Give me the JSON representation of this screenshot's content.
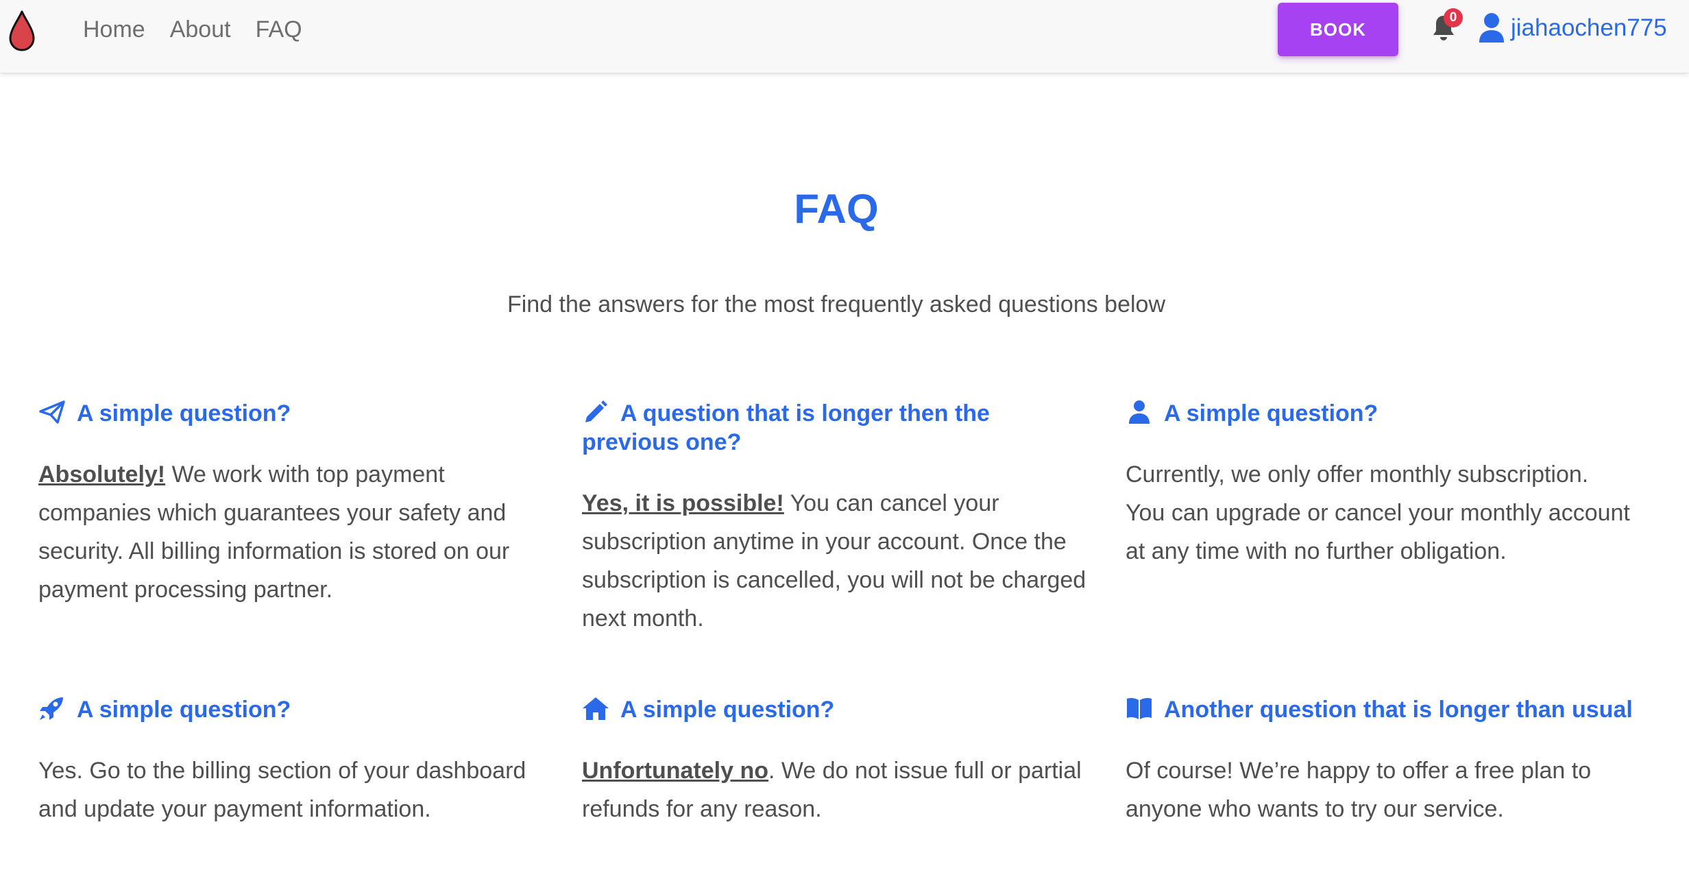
{
  "colors": {
    "brand_blue": "#2a6ae8",
    "book_purple": "#a742f2",
    "badge_red": "#e3344a",
    "logo_red": "#d9434a",
    "text_gray": "#4f4f4f"
  },
  "navbar": {
    "logo_icon": "blood-drop-icon",
    "links": [
      "Home",
      "About",
      "FAQ"
    ],
    "book_label": "BOOK",
    "notifications": {
      "icon": "bell-icon",
      "count": "0"
    },
    "user": {
      "icon": "user-icon",
      "name": "jiahaochen775"
    }
  },
  "header": {
    "title": "FAQ",
    "subtitle": "Find the answers for the most frequently asked questions below"
  },
  "faqs": [
    {
      "icon": "paper-plane-icon",
      "question": "A simple question?",
      "lead": "Absolutely!",
      "answer": " We work with top payment companies which guarantees your safety and security. All billing information is stored on our payment processing partner."
    },
    {
      "icon": "pencil-icon",
      "question": "A question that is longer then the previous one?",
      "lead": "Yes, it is possible!",
      "answer": " You can cancel your subscription anytime in your account. Once the subscription is cancelled, you will not be charged next month."
    },
    {
      "icon": "user-icon",
      "question": "A simple question?",
      "lead": "",
      "answer": "Currently, we only offer monthly subscription. You can upgrade or cancel your monthly account at any time with no further obligation."
    },
    {
      "icon": "rocket-icon",
      "question": "A simple question?",
      "lead": "",
      "answer": "Yes. Go to the billing section of your dashboard and update your payment information."
    },
    {
      "icon": "home-icon",
      "question": "A simple question?",
      "lead": "Unfortunately no",
      "answer": ". We do not issue full or partial refunds for any reason."
    },
    {
      "icon": "book-open-icon",
      "question": "Another question that is longer than usual",
      "lead": "",
      "answer": "Of course! We’re happy to offer a free plan to anyone who wants to try our service."
    }
  ]
}
